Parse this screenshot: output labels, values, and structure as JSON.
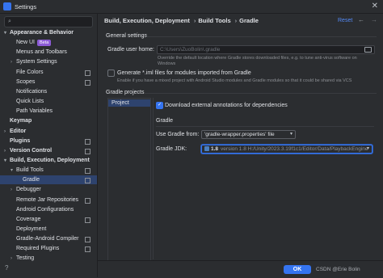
{
  "window": {
    "title": "Settings"
  },
  "sidebar": {
    "items": [
      {
        "label": "Appearance & Behavior",
        "level": 0,
        "expanded": true,
        "bold": true
      },
      {
        "label": "New UI",
        "level": 1,
        "badge": "Beta"
      },
      {
        "label": "Menus and Toolbars",
        "level": 1
      },
      {
        "label": "System Settings",
        "level": 1,
        "collapsed": true
      },
      {
        "label": "File Colors",
        "level": 1,
        "icon": true
      },
      {
        "label": "Scopes",
        "level": 1,
        "icon": true
      },
      {
        "label": "Notifications",
        "level": 1
      },
      {
        "label": "Quick Lists",
        "level": 1
      },
      {
        "label": "Path Variables",
        "level": 1
      },
      {
        "label": "Keymap",
        "level": 0,
        "bold": true
      },
      {
        "label": "Editor",
        "level": 0,
        "collapsed": true,
        "bold": true
      },
      {
        "label": "Plugins",
        "level": 0,
        "bold": true,
        "icon": true
      },
      {
        "label": "Version Control",
        "level": 0,
        "collapsed": true,
        "bold": true,
        "icon": true
      },
      {
        "label": "Build, Execution, Deployment",
        "level": 0,
        "expanded": true,
        "bold": true
      },
      {
        "label": "Build Tools",
        "level": 1,
        "expanded": true,
        "icon": true
      },
      {
        "label": "Gradle",
        "level": 2,
        "selected": true,
        "icon": true
      },
      {
        "label": "Debugger",
        "level": 1,
        "collapsed": true
      },
      {
        "label": "Remote Jar Repositories",
        "level": 1,
        "icon": true
      },
      {
        "label": "Android Configurations",
        "level": 1
      },
      {
        "label": "Coverage",
        "level": 1,
        "icon": true
      },
      {
        "label": "Deployment",
        "level": 1
      },
      {
        "label": "Gradle-Android Compiler",
        "level": 1,
        "icon": true
      },
      {
        "label": "Required Plugins",
        "level": 1,
        "icon": true
      },
      {
        "label": "Testing",
        "level": 1,
        "collapsed": true
      }
    ]
  },
  "breadcrumb": [
    "Build, Execution, Deployment",
    "Build Tools",
    "Gradle"
  ],
  "header": {
    "reset_label": "Reset"
  },
  "general": {
    "section_title": "General settings",
    "gradle_home_label": "Gradle user home:",
    "gradle_home_value": "C:\\Users\\ZuoBolin\\.gradle",
    "gradle_home_hint": "Override the default location where Gradle stores downloaded files, e.g. to tune anti-virus software on Windows",
    "generate_iml_label": "Generate *.iml files for modules imported from Gradle",
    "generate_iml_hint": "Enable if you have a mixed project with Android Studio modules and Gradle modules so that it could be shared via VCS"
  },
  "projects": {
    "section_title": "Gradle projects",
    "items": [
      "Project"
    ],
    "download_annotations_label": "Download external annotations for dependencies",
    "gradle_section": "Gradle",
    "use_gradle_from_label": "Use Gradle from:",
    "use_gradle_from_value": "'gradle-wrapper.properties' file",
    "gradle_jdk_label": "Gradle JDK:",
    "gradle_jdk_version": "1.8",
    "gradle_jdk_path": "version 1.8 H:/Unity/2023.3.19f1c1/Editor/Data/PlaybackEngine"
  },
  "footer": {
    "ok_label": "OK",
    "cancel_label": "Cancel",
    "watermark": "CSDN @Erie Bolin"
  },
  "colors": {
    "background": "#2b2d30",
    "accent": "#3574f0",
    "selection": "#2e436e",
    "link": "#548af7"
  }
}
